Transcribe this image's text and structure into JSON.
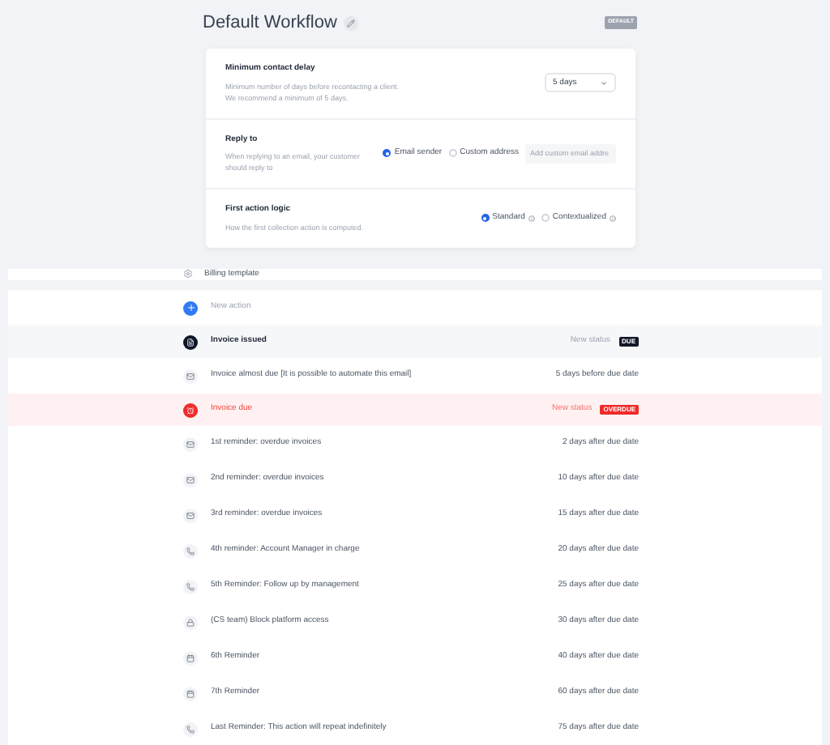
{
  "header": {
    "title": "Default Workflow",
    "badge": "DEFAULT"
  },
  "settings": [
    {
      "kind": "select",
      "title": "Minimum contact delay",
      "description": "Minimum number of days before recontacting a client.",
      "description_2": "We recommend a minimum of 5 days.",
      "value": "5 days"
    },
    {
      "kind": "radio",
      "title": "Reply to",
      "description": "When replying to an email, your customer should reply to",
      "options": [
        {
          "label": "Email sender",
          "selected": true
        },
        {
          "label": "Custom address",
          "selected": false
        }
      ],
      "placeholder": "Add custom email addre"
    },
    {
      "kind": "radio",
      "title": "First action logic",
      "description": "How the first collection action is computed.",
      "options": [
        {
          "label": "Standard",
          "selected": true
        },
        {
          "label": "Contextualized",
          "selected": false
        }
      ]
    }
  ],
  "template": {
    "label": "Billing template"
  },
  "actions": [
    {
      "kind": "add",
      "label": "New action"
    },
    {
      "kind": "milestone",
      "label": "Invoice issued",
      "status_label": "New status",
      "badge": "DUE",
      "color": "#111827"
    },
    {
      "kind": "mail",
      "label": "Invoice almost due [It is possible to automate this email]",
      "timing": "5 days before due date"
    },
    {
      "kind": "alert",
      "label": "Invoice due",
      "status_label": "New status",
      "badge": "OVERDUE",
      "color": "#ef2b2b"
    },
    {
      "kind": "mail",
      "label": "1st reminder: overdue invoices",
      "timing": "2 days after due date"
    },
    {
      "kind": "mail",
      "label": "2nd reminder: overdue invoices",
      "timing": "10 days after due date"
    },
    {
      "kind": "mail",
      "label": "3rd reminder: overdue invoices",
      "timing": "15 days after due date"
    },
    {
      "kind": "phone",
      "label": "4th reminder: Account Manager in charge",
      "timing": "20 days after due date"
    },
    {
      "kind": "phone",
      "label": "5th Reminder: Follow up by management",
      "timing": "25 days after due date"
    },
    {
      "kind": "lock",
      "label": "(CS team) Block platform access",
      "timing": "30 days after due date"
    },
    {
      "kind": "calendar",
      "label": "6th Reminder",
      "timing": "40 days after due date"
    },
    {
      "kind": "calendar",
      "label": "7th Reminder",
      "timing": "60 days after due date"
    },
    {
      "kind": "phone",
      "label": "Last Reminder: This action will repeat indefinitely",
      "timing": "75 days after due date"
    }
  ]
}
